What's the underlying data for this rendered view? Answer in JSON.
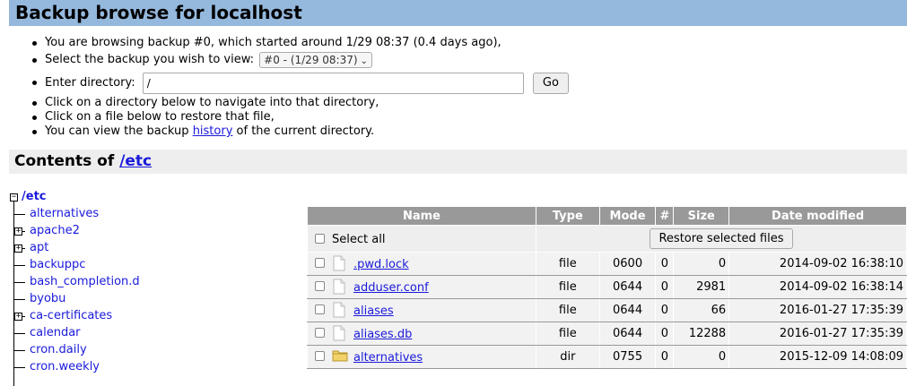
{
  "header": {
    "title": "Backup browse for localhost"
  },
  "info": {
    "browsing": "You are browsing backup #0, which started around 1/29 08:37 (0.4 days ago),",
    "select_label": "Select the backup you wish to view:",
    "select_value": "#0 - (1/29 08:37)",
    "dir_label": "Enter directory:",
    "dir_value": "/",
    "go_label": "Go",
    "click_dir": "Click on a directory below to navigate into that directory,",
    "click_file": "Click on a file below to restore that file,",
    "history_pre": "You can view the backup",
    "history_link": "history",
    "history_post": "of the current directory."
  },
  "contents": {
    "prefix": "Contents of",
    "path": "/etc"
  },
  "tree": {
    "root": "/etc",
    "items": [
      {
        "label": "alternatives",
        "expandable": false
      },
      {
        "label": "apache2",
        "expandable": true
      },
      {
        "label": "apt",
        "expandable": true
      },
      {
        "label": "backuppc",
        "expandable": false
      },
      {
        "label": "bash_completion.d",
        "expandable": false
      },
      {
        "label": "byobu",
        "expandable": false
      },
      {
        "label": "ca-certificates",
        "expandable": true
      },
      {
        "label": "calendar",
        "expandable": false
      },
      {
        "label": "cron.daily",
        "expandable": false
      },
      {
        "label": "cron.weekly",
        "expandable": false
      }
    ]
  },
  "table": {
    "headers": {
      "name": "Name",
      "type": "Type",
      "mode": "Mode",
      "num": "#",
      "size": "Size",
      "date": "Date modified"
    },
    "select_all": "Select all",
    "restore_button": "Restore selected files",
    "rows": [
      {
        "name": ".pwd.lock",
        "type": "file",
        "mode": "0600",
        "num": "0",
        "size": "0",
        "date": "2014-09-02 16:38:10",
        "icon": "file-icon"
      },
      {
        "name": "adduser.conf",
        "type": "file",
        "mode": "0644",
        "num": "0",
        "size": "2981",
        "date": "2014-09-02 16:38:14",
        "icon": "file-icon"
      },
      {
        "name": "aliases",
        "type": "file",
        "mode": "0644",
        "num": "0",
        "size": "66",
        "date": "2016-01-27 17:35:39",
        "icon": "file-icon"
      },
      {
        "name": "aliases.db",
        "type": "file",
        "mode": "0644",
        "num": "0",
        "size": "12288",
        "date": "2016-01-27 17:35:39",
        "icon": "file-icon"
      },
      {
        "name": "alternatives",
        "type": "dir",
        "mode": "0755",
        "num": "0",
        "size": "0",
        "date": "2015-12-09 14:08:09",
        "icon": "folder-icon"
      }
    ]
  },
  "colors": {
    "title_bar": "#95b8dd",
    "link": "#1a1adb",
    "table_header": "#999999",
    "table_cell": "#eeeeee"
  }
}
